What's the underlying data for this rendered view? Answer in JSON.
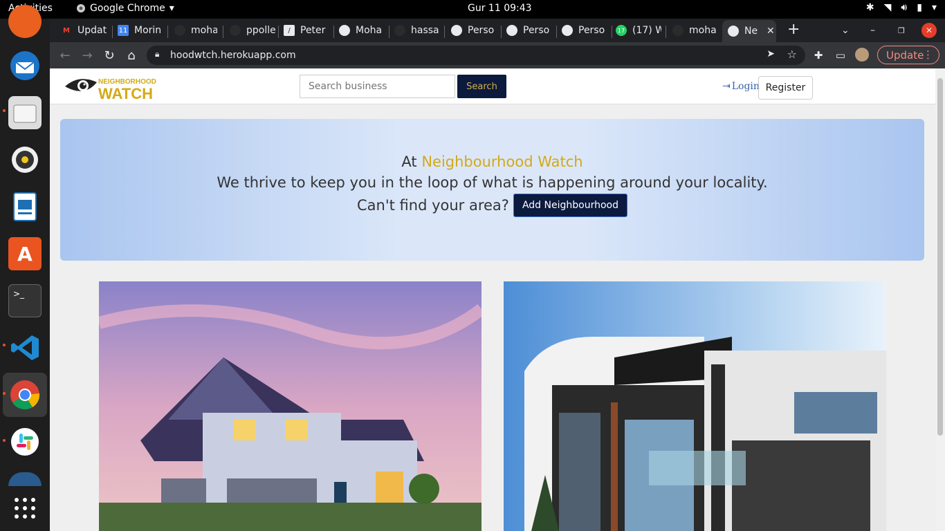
{
  "system": {
    "activities": "Activities",
    "app_name": "Google Chrome",
    "clock": "Gur 11  09:43"
  },
  "tabs": [
    {
      "label": "Updat",
      "icon": "gmail-icon",
      "color": "#ea4335"
    },
    {
      "label": "Morin",
      "icon": "calendar-icon",
      "color": "#4285f4"
    },
    {
      "label": "moha",
      "icon": "github-icon",
      "color": "#202124"
    },
    {
      "label": "ppolle",
      "icon": "github-icon",
      "color": "#202124"
    },
    {
      "label": "Peter",
      "icon": "document-icon",
      "color": "#e8eaed"
    },
    {
      "label": "Moha",
      "icon": "globe-icon",
      "color": "#e8eaed"
    },
    {
      "label": "hassa",
      "icon": "github-icon",
      "color": "#202124"
    },
    {
      "label": "Perso",
      "icon": "globe-icon",
      "color": "#e8eaed"
    },
    {
      "label": "Perso",
      "icon": "globe-icon",
      "color": "#e8eaed"
    },
    {
      "label": "Perso",
      "icon": "globe-icon",
      "color": "#e8eaed"
    },
    {
      "label": "(17) W",
      "icon": "whatsapp-icon",
      "color": "#25d366"
    },
    {
      "label": "moha",
      "icon": "github-icon",
      "color": "#202124"
    },
    {
      "label": "Ne",
      "icon": "globe-icon",
      "color": "#e8eaed",
      "active": true
    }
  ],
  "toolbar": {
    "url": "hoodwtch.herokuapp.com",
    "update_label": "Update"
  },
  "site": {
    "logo_top": "NEIGHBORHOOD",
    "logo_bottom": "WATCH",
    "search_placeholder": "Search business",
    "search_label": "Search",
    "login_label": "Login",
    "register_label": "Register"
  },
  "hero": {
    "at": "At",
    "brand": "Neighbourhood Watch",
    "line2": "We thrive to keep you in the loop of what is happening around your locality.",
    "line3": "Can't find your area?",
    "add_label": "Add Neighbourhood"
  },
  "colors": {
    "brand_gold": "#d4a915",
    "navy": "#0b1a3d",
    "hero_blue": "#a9c5ef"
  }
}
